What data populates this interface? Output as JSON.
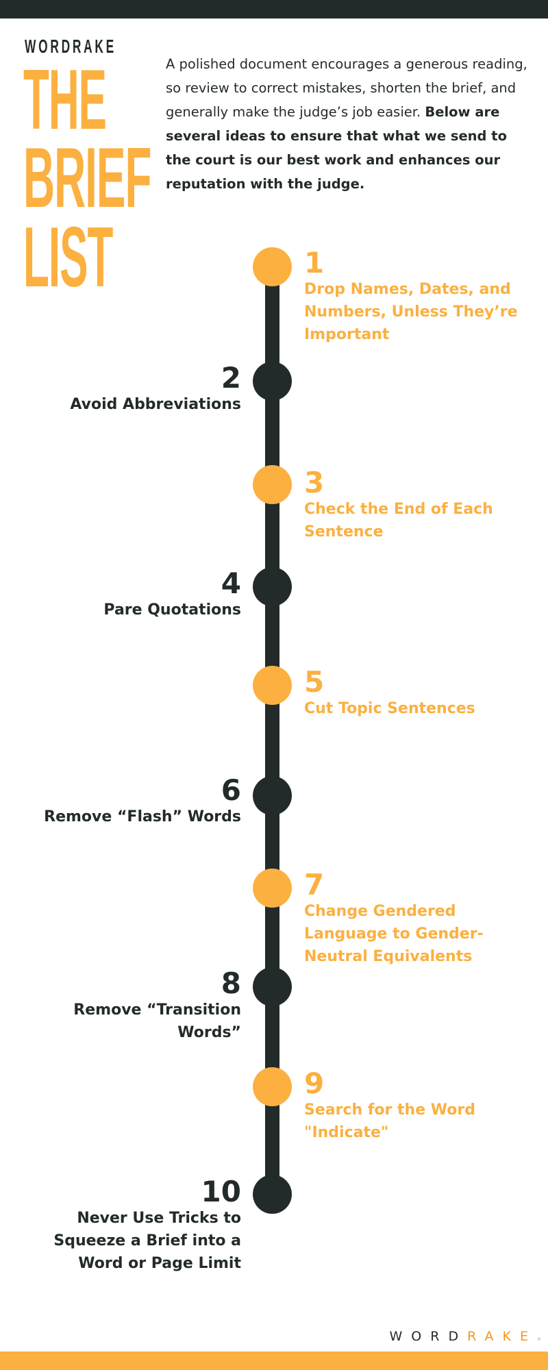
{
  "brand": {
    "name": "WORDRAKE",
    "footer_logo_part1": "WORD",
    "footer_logo_part2": "RAKE",
    "footer_tm": "®"
  },
  "title": {
    "lines": [
      "THE",
      "BRIEF",
      "LIST"
    ]
  },
  "intro": {
    "regular": "A polished document encourages a generous reading, so review to correct mistakes, shorten the brief, and generally make the judge’s job easier.",
    "bold": "Below are several ideas to ensure that what we send to the court is our best work and enhances our reputation with the judge."
  },
  "colors": {
    "accent": "#fbb040",
    "dark": "#232b2a",
    "logo_orange": "#f7941d",
    "background": "#ffffff"
  },
  "items": [
    {
      "number": "1",
      "label": "Drop Names, Dates, and Numbers, Unless They’re Important",
      "side": "right",
      "color": "orange"
    },
    {
      "number": "2",
      "label": "Avoid Abbreviations",
      "side": "left",
      "color": "dark"
    },
    {
      "number": "3",
      "label": "Check the End of Each Sentence",
      "side": "right",
      "color": "orange"
    },
    {
      "number": "4",
      "label": "Pare Quotations",
      "side": "left",
      "color": "dark"
    },
    {
      "number": "5",
      "label": "Cut Topic Sentences",
      "side": "right",
      "color": "orange"
    },
    {
      "number": "6",
      "label": "Remove “Flash” Words",
      "side": "left",
      "color": "dark"
    },
    {
      "number": "7",
      "label": "Change Gendered Language to Gender-Neutral Equivalents",
      "side": "right",
      "color": "orange"
    },
    {
      "number": "8",
      "label": "Remove “Transition Words”",
      "side": "left",
      "color": "dark"
    },
    {
      "number": "9",
      "label": "Search for the Word \"Indicate\"",
      "side": "right",
      "color": "orange"
    },
    {
      "number": "10",
      "label": "Never Use Tricks to Squeeze a Brief into a Word or Page Limit",
      "side": "left",
      "color": "dark"
    }
  ]
}
